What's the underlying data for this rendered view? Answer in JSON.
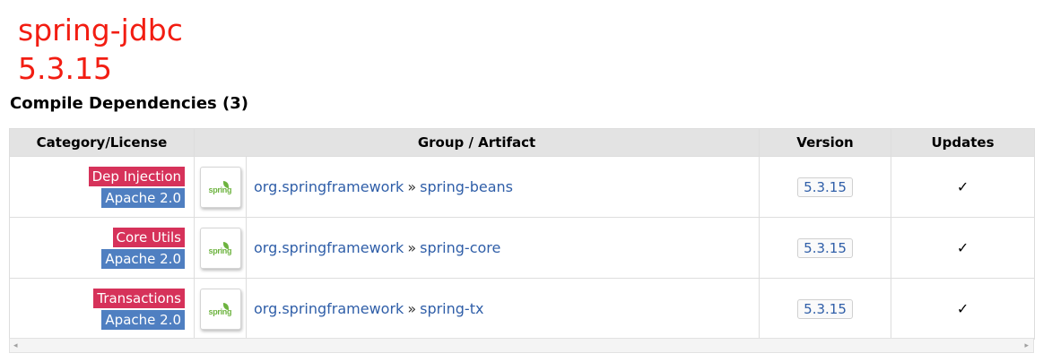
{
  "annotation": {
    "line1": "spring-jdbc",
    "line2": "5.3.15"
  },
  "section": {
    "title": "Compile Dependencies (3)"
  },
  "table": {
    "headers": {
      "category": "Category/License",
      "artifact": "Group / Artifact",
      "version": "Version",
      "updates": "Updates"
    },
    "rows": [
      {
        "category": "Dep Injection",
        "license": "Apache 2.0",
        "logo": "spring",
        "group": "org.springframework",
        "separator": "»",
        "artifact": "spring-beans",
        "version": "5.3.15",
        "updates": "✓"
      },
      {
        "category": "Core Utils",
        "license": "Apache 2.0",
        "logo": "spring",
        "group": "org.springframework",
        "separator": "»",
        "artifact": "spring-core",
        "version": "5.3.15",
        "updates": "✓"
      },
      {
        "category": "Transactions",
        "license": "Apache 2.0",
        "logo": "spring",
        "group": "org.springframework",
        "separator": "»",
        "artifact": "spring-tx",
        "version": "5.3.15",
        "updates": "✓"
      }
    ]
  },
  "scrollbar": {
    "left_arrow": "◂",
    "right_arrow": "▸"
  },
  "colors": {
    "annotation": "#f21d12",
    "category_badge": "#d6325a",
    "license_badge": "#4f7fc1",
    "link": "#2f5ea8",
    "header_bg": "#e3e3e3",
    "spring_green": "#6db33f"
  }
}
